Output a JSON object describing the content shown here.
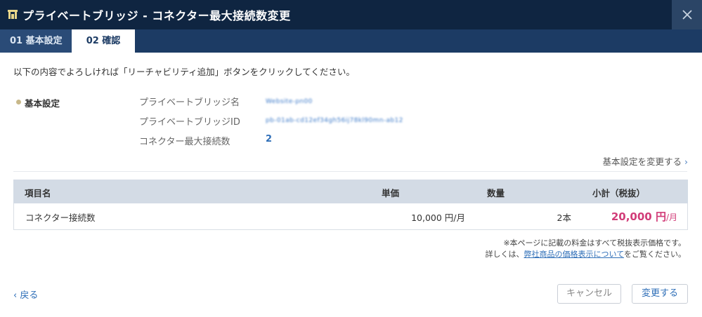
{
  "dialog": {
    "title": "プライベートブリッジ - コネクター最大接続数変更"
  },
  "tabs": [
    {
      "label": "01 基本設定"
    },
    {
      "label": "02 確認"
    }
  ],
  "intro": "以下の内容でよろしければ「リーチャビリティ追加」ボタンをクリックしてください。",
  "basic": {
    "section_title": "基本設定",
    "fields": [
      {
        "label": "プライベートブリッジ名",
        "value": "Website-pn00"
      },
      {
        "label": "プライベートブリッジID",
        "value": "pb-01ab-cd12ef34gh56ij78kl90mn-ab12"
      },
      {
        "label": "コネクター最大接続数",
        "value": "2"
      }
    ],
    "change_link": "基本設定を変更する"
  },
  "table": {
    "headers": {
      "item": "項目名",
      "price": "単価",
      "qty": "数量",
      "subtotal": "小計（税抜）"
    },
    "rows": [
      {
        "item": "コネクター接続数",
        "price": "10,000 円/月",
        "qty": "2本",
        "subtotal_amount": "20,000 円",
        "subtotal_unit": "/月"
      }
    ]
  },
  "notes": {
    "line1": "※本ページに記載の料金はすべて税抜表示価格です。",
    "line2_prefix": "詳しくは、",
    "line2_link": "弊社商品の価格表示について",
    "line2_suffix": "をご覧ください。"
  },
  "footer": {
    "back": "戻る",
    "cancel": "キャンセル",
    "submit": "変更する"
  },
  "colors": {
    "titlebar": "#0f2541",
    "tabbar": "#1c3b64",
    "accent": "#2f6fb8",
    "price": "#d13c78"
  },
  "icons": {
    "title": "bridge-icon",
    "close": "close-icon",
    "back": "chevron-left-icon",
    "link": "chevron-right-icon"
  }
}
